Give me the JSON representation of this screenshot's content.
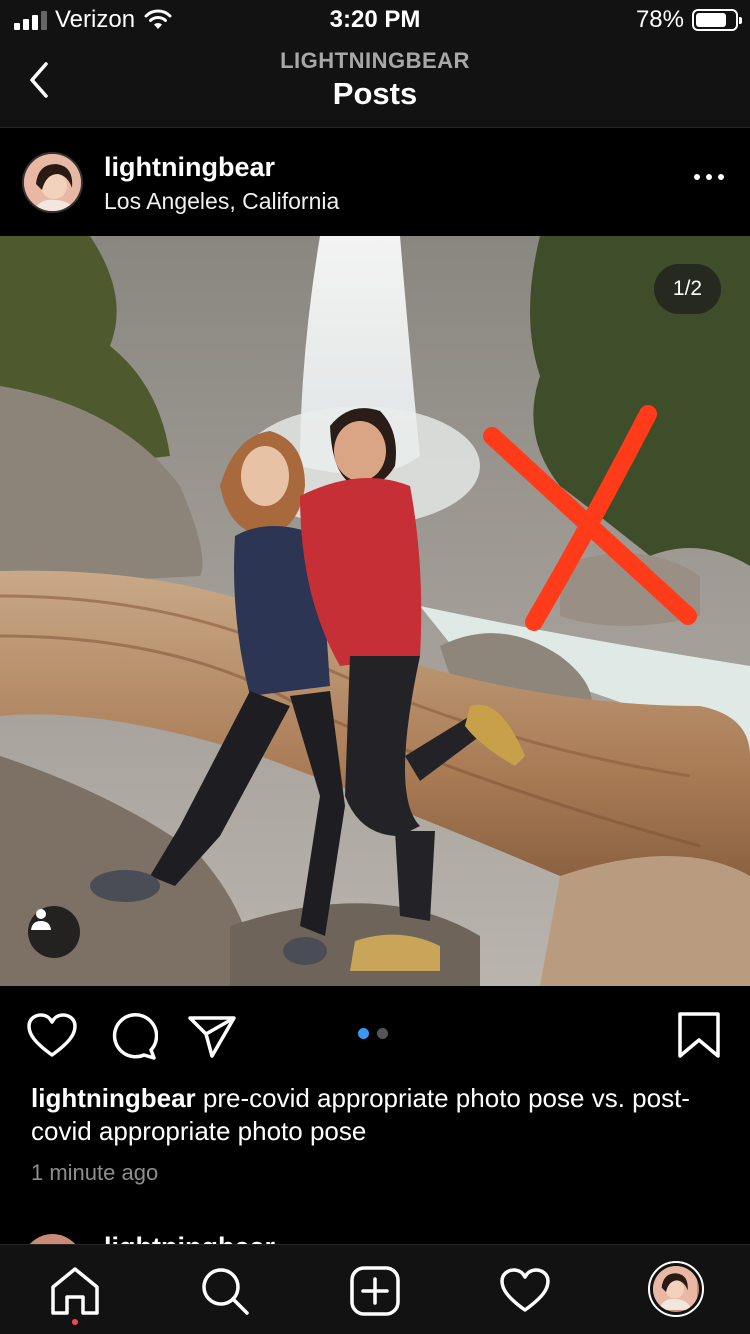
{
  "status_bar": {
    "carrier": "Verizon",
    "time": "3:20 PM",
    "battery": "78%",
    "battery_level": 0.78
  },
  "nav": {
    "subtitle": "LIGHTNINGBEAR",
    "title": "Posts",
    "back_icon": "chevron-left-icon"
  },
  "post": {
    "username": "lightningbear",
    "location": "Los Angeles, California",
    "more_icon": "more-horizontal-icon",
    "image_counter": "1/2",
    "carousel_index": 1,
    "carousel_total": 2,
    "caption_user": "lightningbear",
    "caption_text": " pre-covid appropriate photo pose vs. post-covid appropriate photo pose",
    "time_ago": "1 minute ago",
    "action_icons": [
      "heart-icon",
      "comment-icon",
      "share-icon",
      "bookmark-icon"
    ]
  },
  "next_post": {
    "username": "lightningbear"
  },
  "tab_bar": {
    "items": [
      "home-icon",
      "search-icon",
      "new-post-icon",
      "activity-icon",
      "profile-avatar"
    ],
    "active": "home-icon",
    "accent": "#ed4956"
  },
  "colors": {
    "background": "#000000",
    "bar": "#121212",
    "carousel_active": "#3897f0",
    "x_mark": "#ff3b1a"
  }
}
